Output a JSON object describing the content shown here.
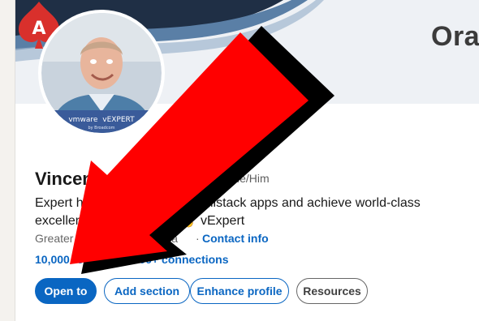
{
  "profile": {
    "name": "Vincent",
    "pronouns": "He/Him",
    "headline_line1_start": "Expert help",
    "headline_line1_end": "va Fullstack apps and achieve world-class",
    "headline_line2_start": "excellence",
    "headline_line2_end": "✌ vExpert",
    "location": "Greater Lille",
    "location_tail": "a",
    "separator": "·",
    "contact_info": "Contact info",
    "followers": "10,000 followers",
    "connections": "500+ connections",
    "stats_separator": " · ",
    "avatar_badge_brand": "vmware",
    "avatar_badge_title": "vEXPERT",
    "avatar_badge_sub": "by Broadcom"
  },
  "banner": {
    "brand_text": "Orac",
    "logo_letter": "A",
    "accent_color": "#d9302c"
  },
  "actions": {
    "open_to": "Open to",
    "add_section": "Add section",
    "enhance_profile": "Enhance profile",
    "resources": "Resources"
  },
  "colors": {
    "link": "#0a66c2",
    "arrow": "#ff0000",
    "arrow_shadow": "#000000"
  }
}
